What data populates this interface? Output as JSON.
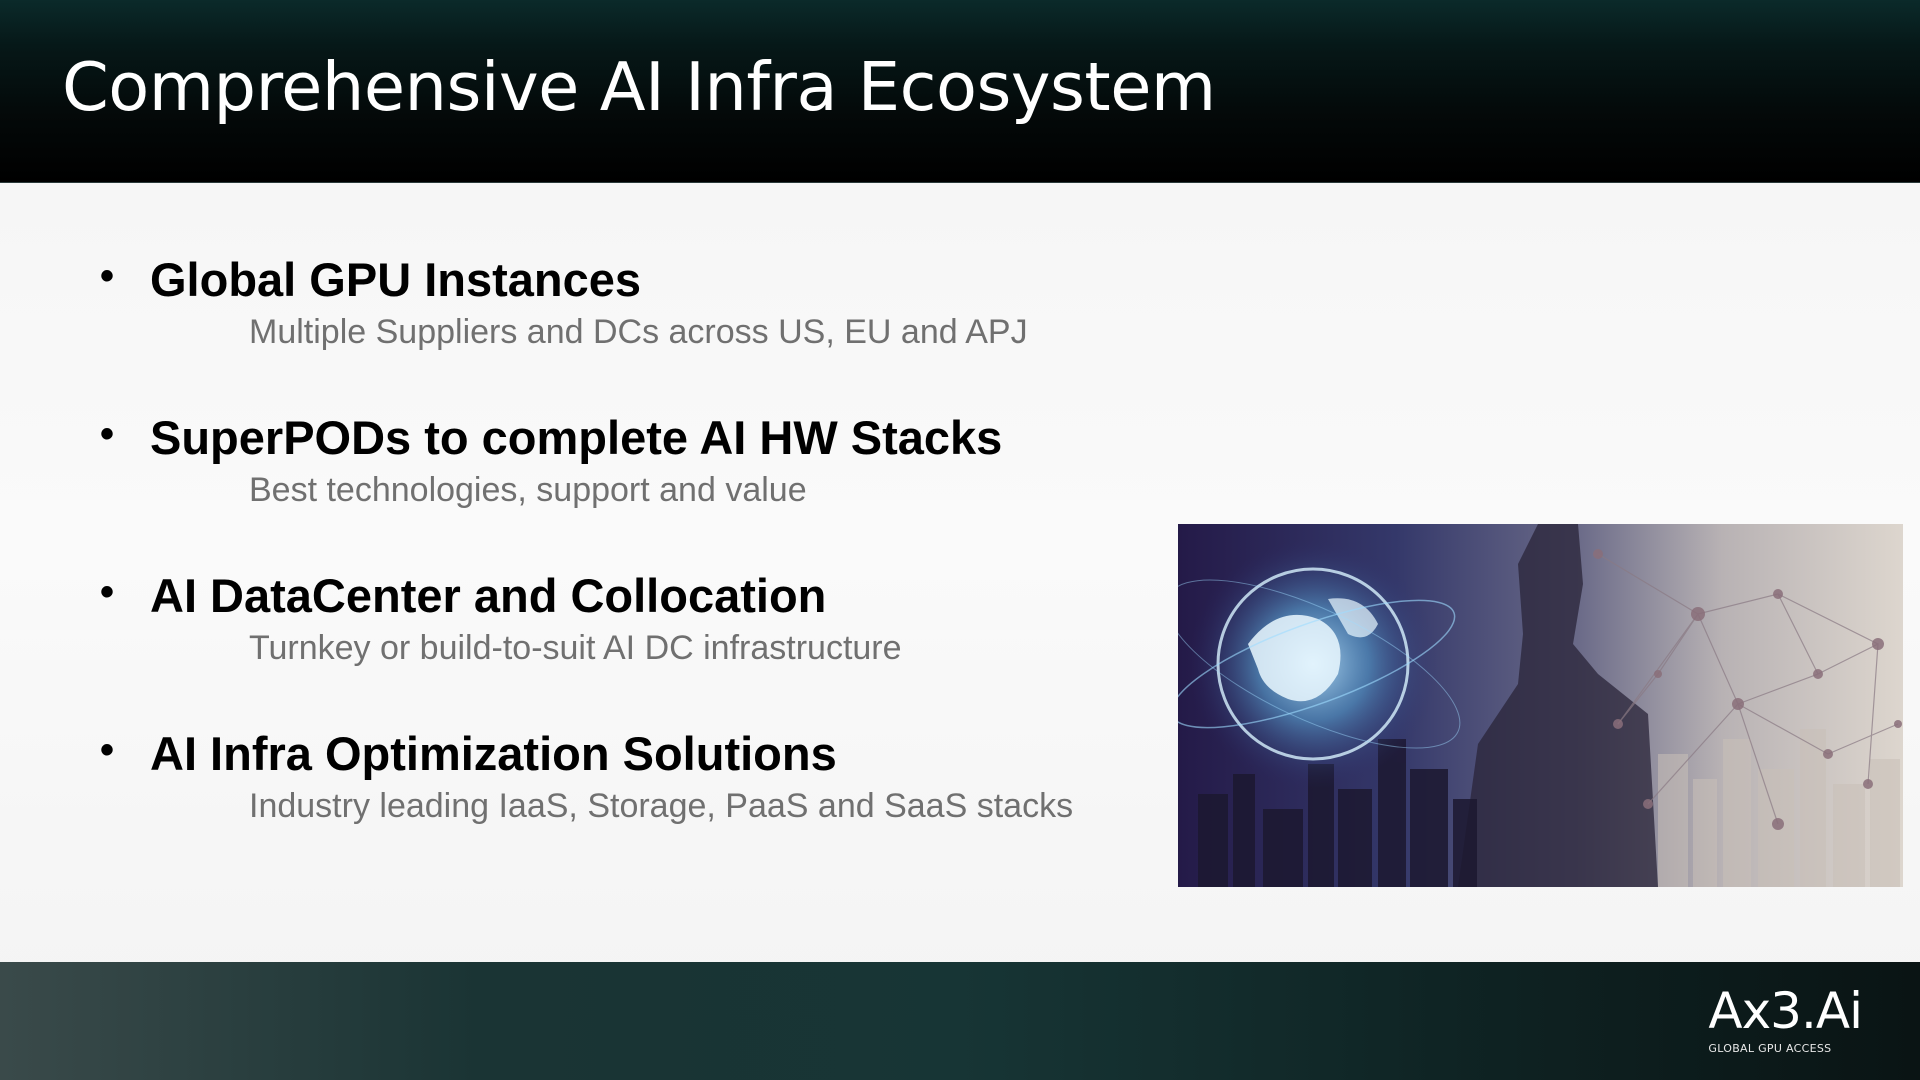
{
  "slide": {
    "title": "Comprehensive AI Infra Ecosystem"
  },
  "bullets": [
    {
      "title": "Global GPU Instances",
      "subtitle": "Multiple Suppliers and DCs across US, EU and APJ"
    },
    {
      "title": "SuperPODs  to complete AI HW Stacks",
      "subtitle": "Best technologies, support and value"
    },
    {
      "title": "AI DataCenter and Collocation",
      "subtitle": "Turnkey or build-to-suit AI DC infrastructure"
    },
    {
      "title": "AI Infra Optimization Solutions",
      "subtitle": "Industry leading IaaS, Storage, PaaS and SaaS stacks"
    }
  ],
  "bullet_symbol": "•",
  "image": {
    "icon": "globe-network-person-city-photo"
  },
  "footer": {
    "logo_text": "Ax3.Ai",
    "logo_tagline": "GLOBAL GPU ACCESS"
  },
  "colors": {
    "header_bg": "#040a0a",
    "footer_bg": "#173535",
    "title_text": "#ffffff",
    "bullet_title": "#000000",
    "bullet_subtitle": "#707070"
  }
}
